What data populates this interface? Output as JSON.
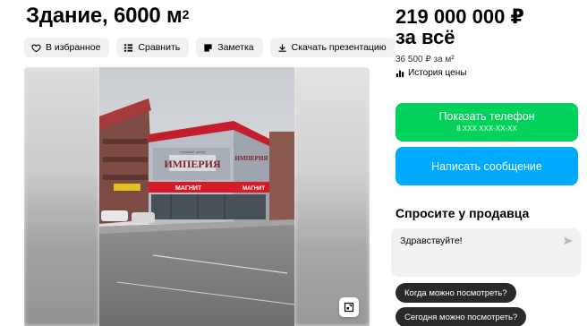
{
  "listing": {
    "title": "Здание, 6000 м",
    "title_sup": "2"
  },
  "toolbar": {
    "favorite": "В избранное",
    "compare": "Сравнить",
    "note": "Заметка",
    "download": "Скачать презентацию"
  },
  "gallery": {
    "sign_main": "ИМПЕРИЯ",
    "sign_small": "торговый центр",
    "store_sign": "МАГНИТ"
  },
  "price": {
    "amount": "219 000 000 ₽",
    "qualifier": "за всё",
    "per_m2": "36 500 ₽ за м²",
    "history": "История цены"
  },
  "contact": {
    "phone_label": "Показать телефон",
    "phone_masked": "8 XXX XXX-XX-XX",
    "message_label": "Написать сообщение"
  },
  "ask": {
    "title": "Спросите у продавца",
    "message": "Здравствуйте!",
    "chips": [
      "Когда можно посмотреть?",
      "Сегодня можно посмотреть?"
    ]
  },
  "colors": {
    "phone_button": "#02d15c",
    "message_button": "#00aaff",
    "chip_bg": "#2a2a2a"
  }
}
